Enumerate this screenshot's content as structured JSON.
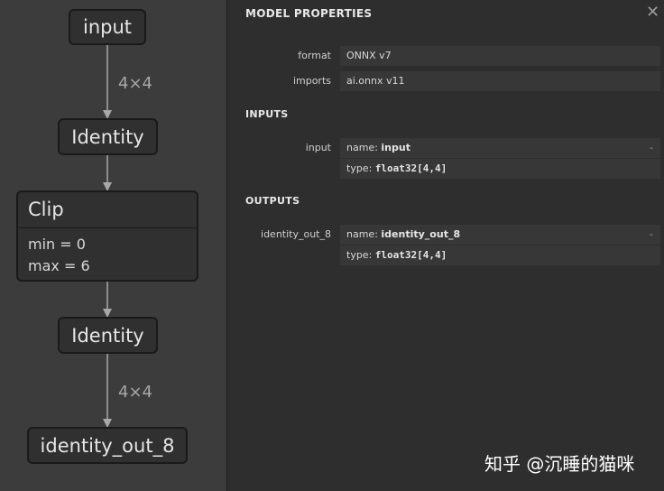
{
  "graph": {
    "nodes": {
      "input": "input",
      "identity1": "Identity",
      "clip": {
        "title": "Clip",
        "attr_min": "min = 0",
        "attr_max": "max = 6"
      },
      "identity2": "Identity",
      "output": "identity_out_8"
    },
    "edge_labels": {
      "input_to_identity": "4×4",
      "identity_to_output": "4×4"
    }
  },
  "panel": {
    "title": "MODEL PROPERTIES",
    "close_glyph": "✕",
    "properties": {
      "format_label": "format",
      "format_value": "ONNX v7",
      "imports_label": "imports",
      "imports_value": "ai.onnx v11"
    },
    "inputs": {
      "title": "INPUTS",
      "label": "input",
      "name_prefix": "name: ",
      "name_value": "input",
      "type_prefix": "type: ",
      "type_value": "float32[4,4]",
      "expander": "-"
    },
    "outputs": {
      "title": "OUTPUTS",
      "label": "identity_out_8",
      "name_prefix": "name: ",
      "name_value": "identity_out_8",
      "type_prefix": "type: ",
      "type_value": "float32[4,4]",
      "expander": "-"
    }
  },
  "watermark": "知乎 @沉睡的猫咪",
  "colors": {
    "graph_bg": "#3c3c3c",
    "panel_bg": "#2e2e2e",
    "node_bg": "#303030",
    "edge": "#a8a8a8"
  }
}
